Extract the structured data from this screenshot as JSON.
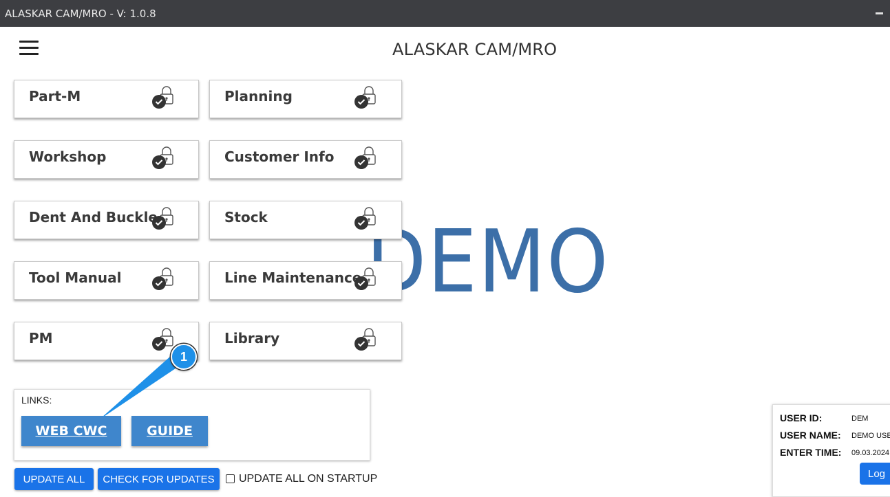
{
  "window": {
    "title": "ALASKAR CAM/MRO - V: 1.0.8"
  },
  "header": {
    "title": "ALASKAR CAM/MRO"
  },
  "watermark": "DEMO",
  "modules": [
    {
      "label": "Part-M"
    },
    {
      "label": "Planning"
    },
    {
      "label": "Workshop"
    },
    {
      "label": "Customer Info"
    },
    {
      "label": "Dent And Buckle"
    },
    {
      "label": "Stock"
    },
    {
      "label": "Tool Manual"
    },
    {
      "label": "Line Maintenance"
    },
    {
      "label": "PM"
    },
    {
      "label": "Library"
    }
  ],
  "links": {
    "label": "LINKS:",
    "web_cwc": "WEB CWC",
    "guide": "GUIDE"
  },
  "footer": {
    "update_all": "UPDATE ALL",
    "check_updates": "CHECK FOR UPDATES",
    "startup_label": "UPDATE ALL ON STARTUP",
    "startup_checked": false
  },
  "user": {
    "id_label": "USER ID:",
    "id_value": "DEM",
    "name_label": "USER NAME:",
    "name_value": "DEMO USE",
    "time_label": "ENTER TIME:",
    "time_value": "09.03.2024",
    "log_button": "Log"
  },
  "callout": {
    "number": "1"
  },
  "colors": {
    "accent_blue": "#1a73e8",
    "link_blue": "#3f86cc",
    "demo_blue": "#3c6fa8",
    "titlebar": "#3d3e42"
  }
}
